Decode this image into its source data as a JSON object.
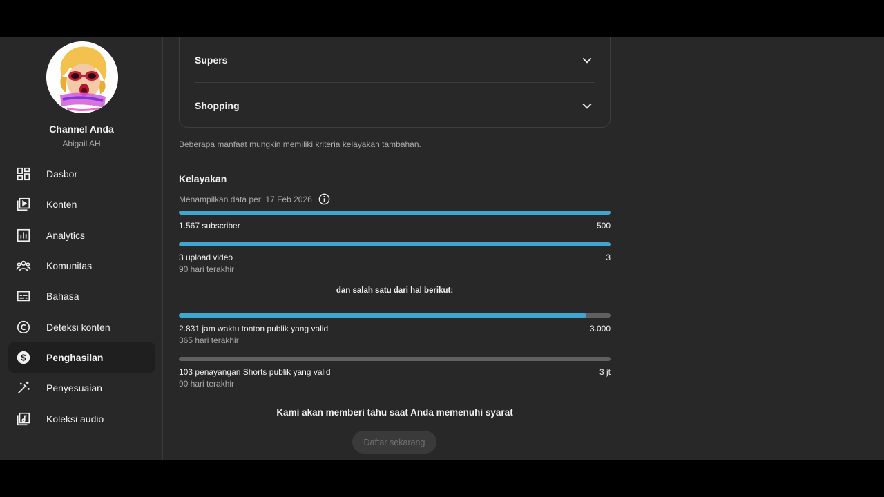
{
  "channel": {
    "title": "Channel Anda",
    "name": "Abigail AH"
  },
  "nav": [
    {
      "label": "Dasbor",
      "icon": "dashboard-icon"
    },
    {
      "label": "Konten",
      "icon": "content-icon"
    },
    {
      "label": "Analytics",
      "icon": "analytics-icon"
    },
    {
      "label": "Komunitas",
      "icon": "community-icon"
    },
    {
      "label": "Bahasa",
      "icon": "subtitles-icon"
    },
    {
      "label": "Deteksi konten",
      "icon": "copyright-icon"
    },
    {
      "label": "Penghasilan",
      "icon": "dollar-icon",
      "active": true
    },
    {
      "label": "Penyesuaian",
      "icon": "magic-wand-icon"
    },
    {
      "label": "Koleksi audio",
      "icon": "audio-library-icon"
    }
  ],
  "accordion": [
    {
      "label": "Supers"
    },
    {
      "label": "Shopping"
    }
  ],
  "note": "Beberapa manfaat mungkin memiliki kriteria kelayakan tambahan.",
  "eligibility": {
    "title": "Kelayakan",
    "data_date": "Menampilkan data per: 17 Feb 2026",
    "requirements": [
      {
        "label": "1.567 subscriber",
        "target": "500",
        "progress": 1.0,
        "sub": ""
      },
      {
        "label": "3 upload video",
        "target": "3",
        "progress": 1.0,
        "sub": "90 hari terakhir"
      }
    ],
    "or_text": "dan salah satu dari hal berikut:",
    "alternatives": [
      {
        "label": "2.831 jam waktu tonton publik yang valid",
        "target": "3.000",
        "progress": 0.9437,
        "sub": "365 hari terakhir"
      },
      {
        "label": "103 penayangan Shorts publik yang valid",
        "target": "3 jt",
        "progress": 0.0,
        "sub": "90 hari terakhir"
      }
    ],
    "notify_text": "Kami akan memberi tahu saat Anda memenuhi syarat",
    "apply_button": "Daftar sekarang"
  },
  "colors": {
    "progress": "#3ea6cf",
    "track": "#606060",
    "background": "#282828"
  }
}
